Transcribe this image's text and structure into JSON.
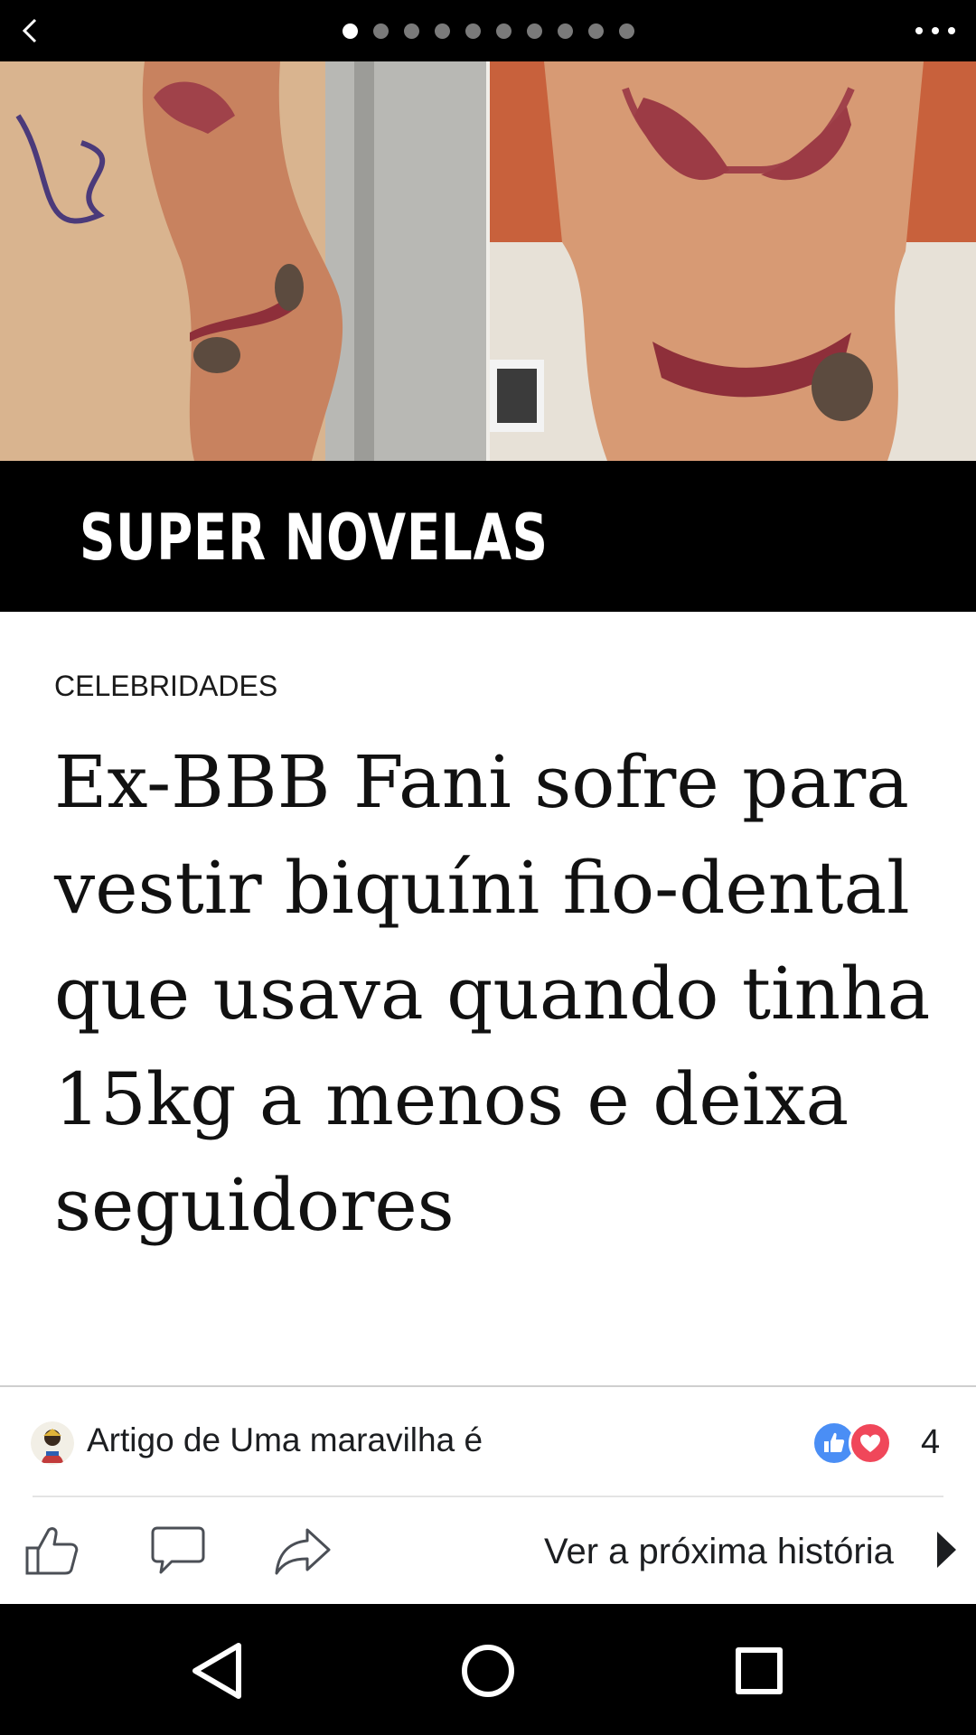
{
  "top_bar": {
    "back_icon": "chevron-left-icon",
    "page_indicator": {
      "total": 10,
      "active_index": 0
    },
    "more_icon": "more-horizontal-icon"
  },
  "hero": {
    "image_description": "two photos of a woman in a striped bikini"
  },
  "brand": {
    "name": "SUPER NOVELAS"
  },
  "article": {
    "category": "CELEBRIDADES",
    "headline": "Ex-BBB Fani sofre para vestir biquíni fio-dental que usava quando tinha 15kg a menos e deixa seguidores"
  },
  "attribution": {
    "text": "Artigo de Uma maravilha é",
    "reactions": [
      "like",
      "love"
    ],
    "reaction_count": "4"
  },
  "actions": {
    "like_icon": "thumbs-up-icon",
    "comment_icon": "comment-icon",
    "share_icon": "share-icon",
    "next_story_label": "Ver a próxima história",
    "next_icon": "triangle-right-icon"
  },
  "system_nav": {
    "back": "back-triangle-icon",
    "home": "home-circle-icon",
    "recents": "recents-square-icon"
  },
  "colors": {
    "like_blue": "#4a8ef5",
    "love_red": "#f0475a",
    "bar_black": "#000000"
  }
}
